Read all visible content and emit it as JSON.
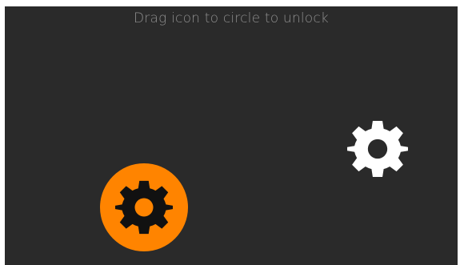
{
  "lock_screen": {
    "instruction": "Drag icon to circle to unlock",
    "target": {
      "icon": "gear-icon",
      "circle_color": "#ff8400",
      "icon_color": "#111111"
    },
    "draggable": {
      "icon": "gear-icon",
      "icon_color": "#ffffff"
    },
    "background_color": "#2a2a2a"
  }
}
